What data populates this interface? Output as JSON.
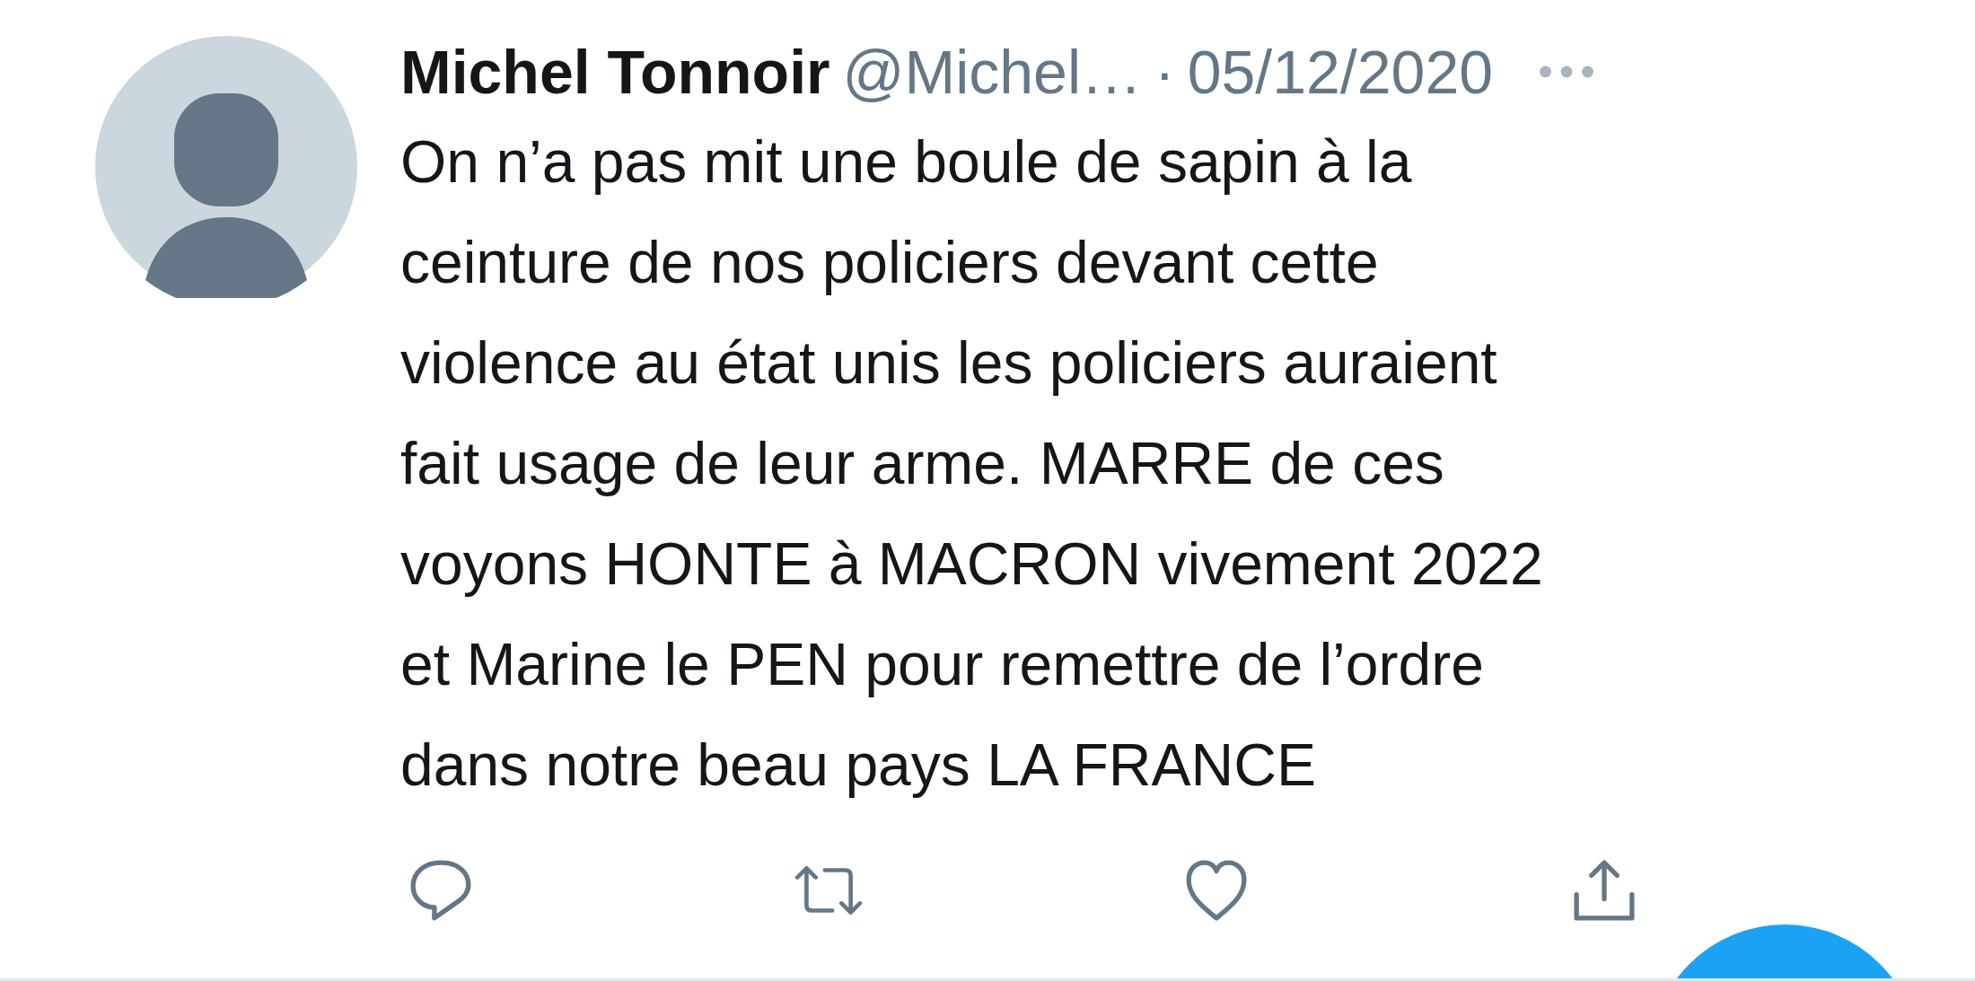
{
  "tweet": {
    "author_name": "Michel Tonnoir",
    "handle": "@Michel…",
    "separator": "·",
    "date": "05/12/2020",
    "text": "On n’a pas mit une boule de sapin à la\nceinture de nos policiers devant cette\nviolence au état unis les policiers auraient\nfait usage de leur arme. MARRE de ces\nvoyons HONTE à MACRON vivement 2022\net Marine le PEN pour remettre de l’ordre\ndans notre beau pays LA FRANCE"
  }
}
